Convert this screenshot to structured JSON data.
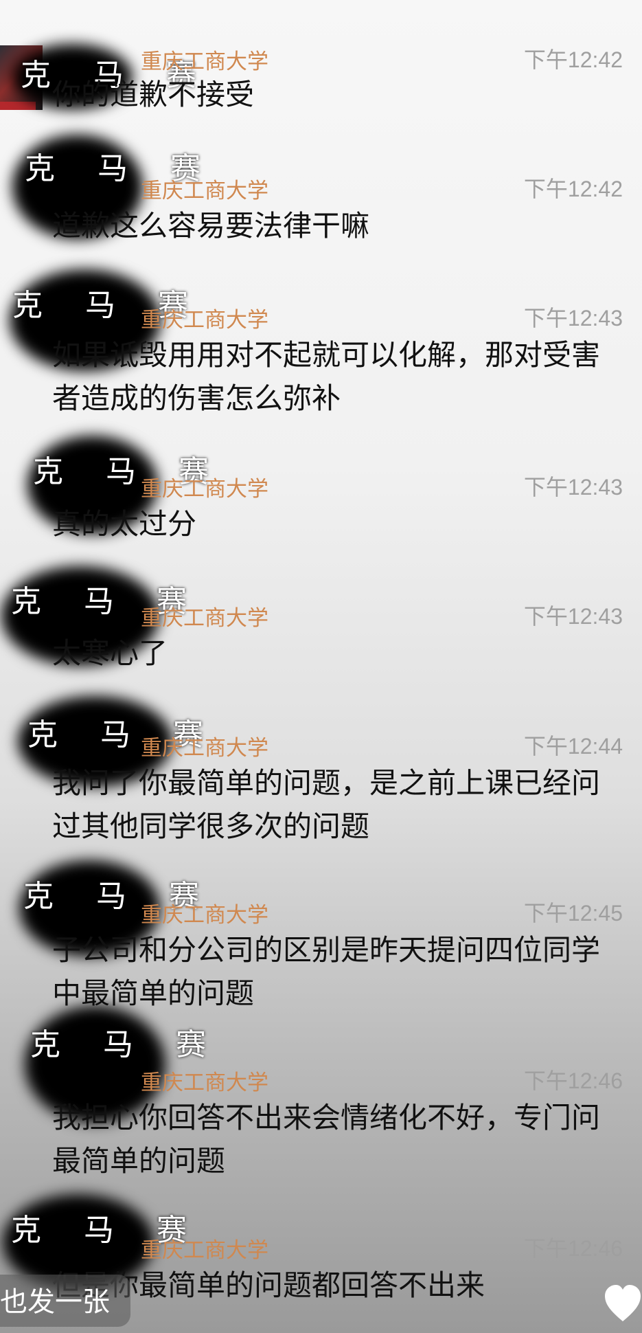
{
  "messages": [
    {
      "sender": "重庆工商大学",
      "time": "下午12:42",
      "text": "你的道歉不接受"
    },
    {
      "sender": "重庆工商大学",
      "time": "下午12:42",
      "text": "道歉这么容易要法律干嘛"
    },
    {
      "sender": "重庆工商大学",
      "time": "下午12:43",
      "text": "如果诋毁用用对不起就可以化解，那对受害者造成的伤害怎么弥补"
    },
    {
      "sender": "重庆工商大学",
      "time": "下午12:43",
      "text": "真的太过分"
    },
    {
      "sender": "重庆工商大学",
      "time": "下午12:43",
      "text": "太寒心了"
    },
    {
      "sender": "重庆工商大学",
      "time": "下午12:44",
      "text": "我问了你最简单的问题，是之前上课已经问过其他同学很多次的问题"
    },
    {
      "sender": "重庆工商大学",
      "time": "下午12:45",
      "text": "子公司和分公司的区别是昨天提问四位同学中最简单的问题"
    },
    {
      "sender": "重庆工商大学",
      "time": "下午12:46",
      "text": "我担心你回答不出来会情绪化不好，专门问最简单的问题"
    },
    {
      "sender": "重庆工商大学",
      "time": "下午12:46",
      "text": "但是你最简单的问题都回答不出来"
    }
  ],
  "watermark": "克 马 赛",
  "bottom_overlay_text": "也发一张",
  "icons": {
    "heart": "heart-icon",
    "avatar": "avatar"
  },
  "colors": {
    "sender": "#d0884f",
    "time": "#9f9f9f",
    "text": "#111111"
  }
}
